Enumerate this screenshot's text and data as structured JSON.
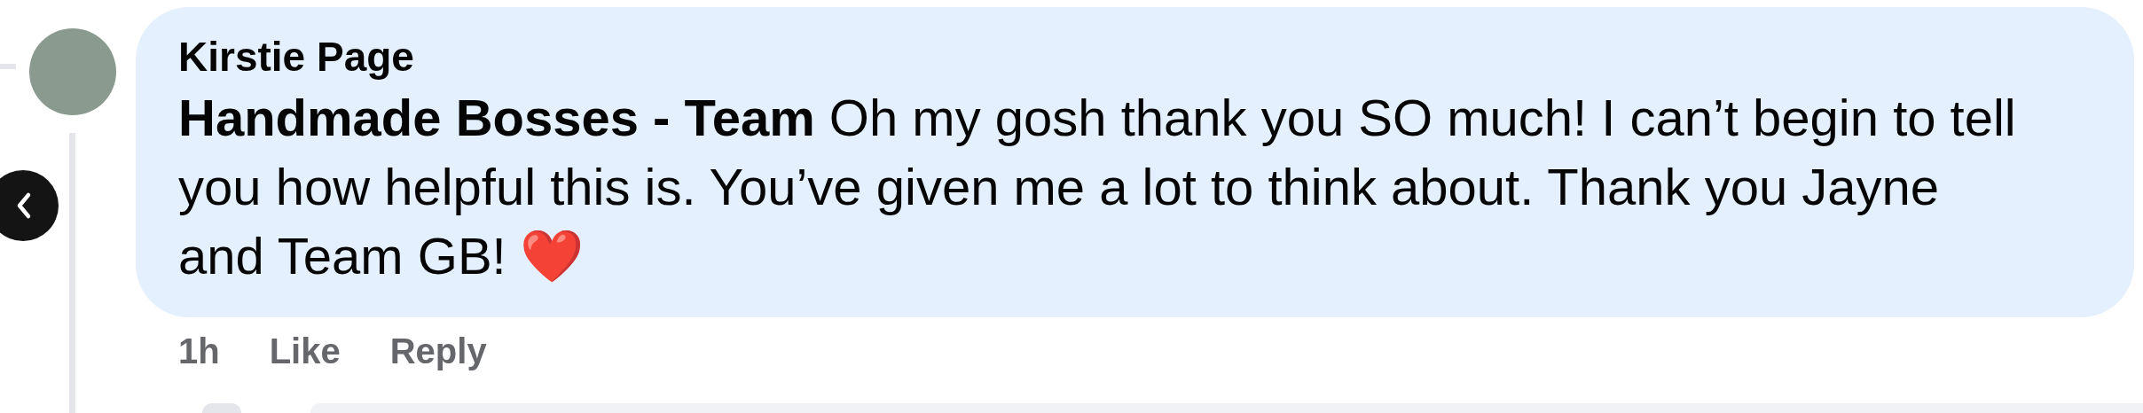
{
  "comment": {
    "author": "Kirstie Page",
    "text": "**Handmade Bosses - Team** Oh my gosh thank you SO much! I can’t begin to tell you how helpful this is. You’ve given me a lot to think about. Thank you Jayne and Team GB! ❤️",
    "time": "1h",
    "actions": [
      "Like",
      "Reply"
    ]
  }
}
